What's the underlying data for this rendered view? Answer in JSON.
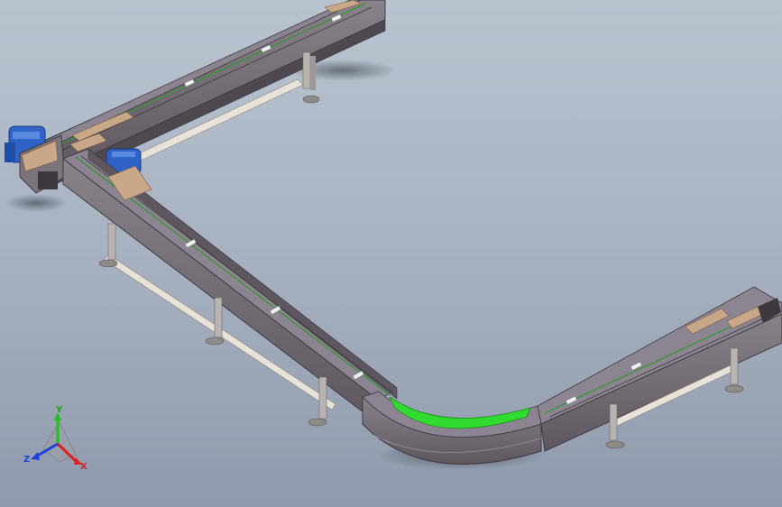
{
  "viewport": {
    "background_top": "#b9c3d0",
    "background_bottom": "#8f9aac"
  },
  "model": {
    "frame_color": "#6e6670",
    "frame_dark": "#4e4850",
    "slat_color": "#c9a88a",
    "motor_color": "#2f63c8",
    "highlight_color": "#2fdc2f",
    "leg_color": "#b9b4b2",
    "crossbar_color": "#e8e2d8"
  },
  "triad": {
    "x_label": "X",
    "y_label": "Y",
    "z_label": "Z",
    "x_color": "#e02020",
    "y_color": "#20c020",
    "z_color": "#2040e0"
  }
}
